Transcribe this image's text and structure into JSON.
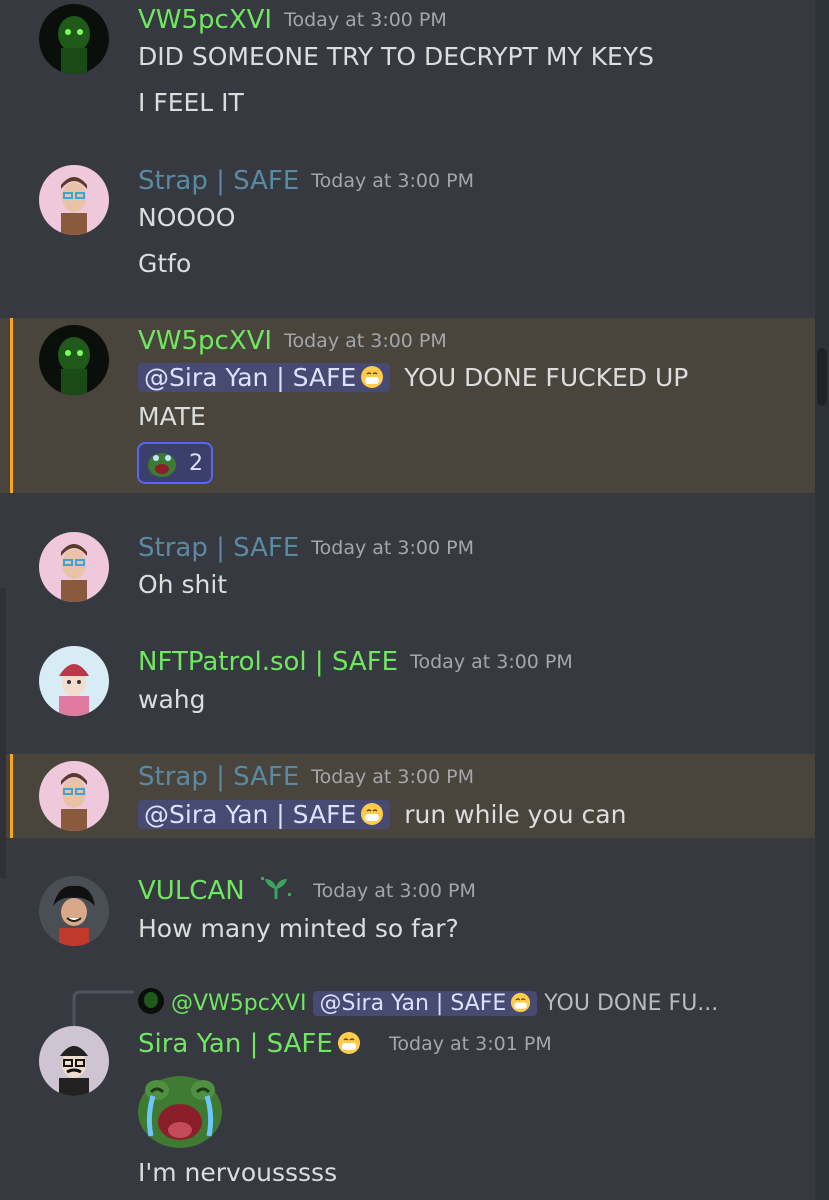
{
  "colors": {
    "green_user": "#6fe860",
    "strap_user": "#5a8aa3",
    "mention_bg": "#474a72",
    "highlight_bg": "#49443c",
    "highlight_bar": "#faa61a"
  },
  "messages": [
    {
      "author": "VW5pcXVI",
      "timestamp": "Today at 3:00 PM",
      "lines": [
        "DID SOMEONE TRY TO DECRYPT MY KEYS",
        "I FEEL IT"
      ]
    },
    {
      "author": "Strap | SAFE",
      "timestamp": "Today at 3:00 PM",
      "lines": [
        "NOOOO",
        "Gtfo"
      ]
    },
    {
      "author": "VW5pcXVI",
      "timestamp": "Today at 3:00 PM",
      "mention": "@Sira Yan | SAFE",
      "text_after_mention": "YOU DONE FUCKED UP",
      "line2": "MATE",
      "reaction": {
        "icon": "crying-frog-icon",
        "count": "2"
      }
    },
    {
      "author": "Strap | SAFE",
      "timestamp": "Today at 3:00 PM",
      "lines": [
        "Oh shit"
      ]
    },
    {
      "author": "NFTPatrol.sol | SAFE",
      "timestamp": "Today at 3:00 PM",
      "lines": [
        "wahg"
      ]
    },
    {
      "author": "Strap | SAFE",
      "timestamp": "Today at 3:00 PM",
      "mention": "@Sira Yan | SAFE",
      "text_after_mention": "run while you can"
    },
    {
      "author": "VULCAN",
      "timestamp": "Today at 3:00 PM",
      "lines": [
        "How many minted so far?"
      ]
    },
    {
      "author": "Sira Yan | SAFE",
      "timestamp": "Today at 3:01 PM",
      "reply": {
        "author": "@VW5pcXVI",
        "mention": "@Sira Yan | SAFE",
        "preview": "YOU DONE FU..."
      },
      "sticker": "crying-frog-sticker",
      "lines": [
        "I'm nervousssss"
      ]
    }
  ]
}
